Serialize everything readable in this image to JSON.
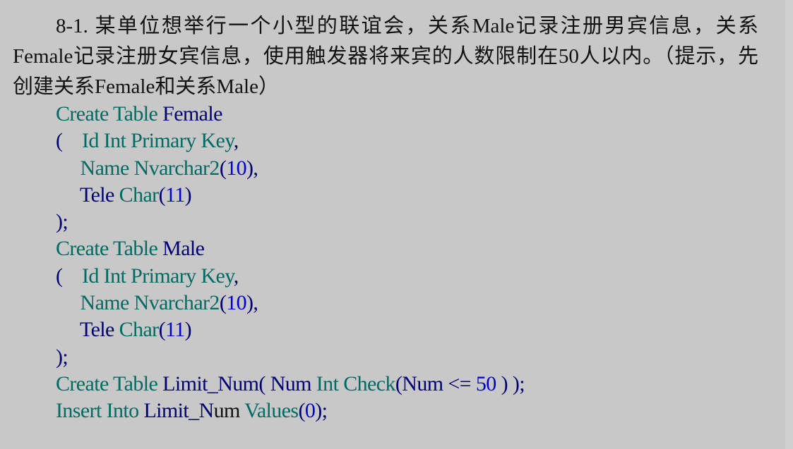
{
  "problem": {
    "text": "8-1. 某单位想举行一个小型的联谊会，关系Male记录注册男宾信息，关系Female记录注册女宾信息，使用触发器将来宾的人数限制在50人以内。（提示，先创建关系Female和关系Male）"
  },
  "colors": {
    "keyword": "#006b63",
    "identifier": "#000070",
    "number": "#0000d0"
  },
  "code_lines": [
    [
      [
        "Create Table ",
        "t"
      ],
      [
        "Female",
        "n"
      ]
    ],
    [
      [
        "(    ",
        "n"
      ],
      [
        "Id Int Primary Key",
        "t"
      ],
      [
        ",",
        "n"
      ]
    ],
    [
      [
        "     Name Nvarchar2",
        "t"
      ],
      [
        "(",
        "n"
      ],
      [
        "10",
        "b"
      ],
      [
        "),",
        "n"
      ]
    ],
    [
      [
        "     Tele ",
        "n"
      ],
      [
        "Char",
        "t"
      ],
      [
        "(",
        "n"
      ],
      [
        "11",
        "b"
      ],
      [
        ")",
        "n"
      ]
    ],
    [
      [
        ");",
        "n"
      ]
    ],
    [
      [
        "Create Table ",
        "t"
      ],
      [
        "Male",
        "n"
      ]
    ],
    [
      [
        "(    ",
        "n"
      ],
      [
        "Id Int Primary Key",
        "t"
      ],
      [
        ",",
        "n"
      ]
    ],
    [
      [
        "     Name Nvarchar2",
        "t"
      ],
      [
        "(",
        "n"
      ],
      [
        "10",
        "b"
      ],
      [
        "),",
        "n"
      ]
    ],
    [
      [
        "     Tele ",
        "n"
      ],
      [
        "Char",
        "t"
      ],
      [
        "(",
        "n"
      ],
      [
        "11",
        "b"
      ],
      [
        ")",
        "n"
      ]
    ],
    [
      [
        ");",
        "n"
      ]
    ],
    [
      [
        "Create Table ",
        "t"
      ],
      [
        "Limit_Num( Num ",
        "n"
      ],
      [
        "Int Check",
        "t"
      ],
      [
        "(Num <= ",
        "n"
      ],
      [
        "50",
        "b"
      ],
      [
        " ) );",
        "n"
      ]
    ],
    [
      [
        "Insert Into ",
        "t"
      ],
      [
        "Limit_N",
        "n"
      ],
      [
        "um ",
        "k"
      ],
      [
        "Values",
        "t"
      ],
      [
        "(",
        "n"
      ],
      [
        "0",
        "b"
      ],
      [
        ");",
        "n"
      ]
    ]
  ]
}
